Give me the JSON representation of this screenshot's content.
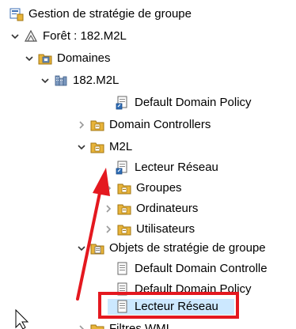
{
  "tree": {
    "root": "Gestion de stratégie de groupe",
    "forest": "Forêt : 182.M2L",
    "domains": "Domaines",
    "domain": "182.M2L",
    "items": {
      "default_domain_policy": "Default Domain Policy",
      "domain_controllers": "Domain Controllers",
      "m2l": "M2L",
      "lecteur_reseau_link": "Lecteur Réseau",
      "groupes": "Groupes",
      "ordinateurs": "Ordinateurs",
      "utilisateurs": "Utilisateurs",
      "gpo_container": "Objets de stratégie de groupe",
      "gpo_default_dc": "Default Domain Controlle",
      "gpo_default_domain": "Default Domain Policy",
      "gpo_lecteur_reseau": "Lecteur Réseau",
      "wmi_filters": "Filtres WMI"
    }
  },
  "colors": {
    "highlight": "#e4181f",
    "selection": "#cce8ff",
    "folder": "#e8b43a"
  }
}
